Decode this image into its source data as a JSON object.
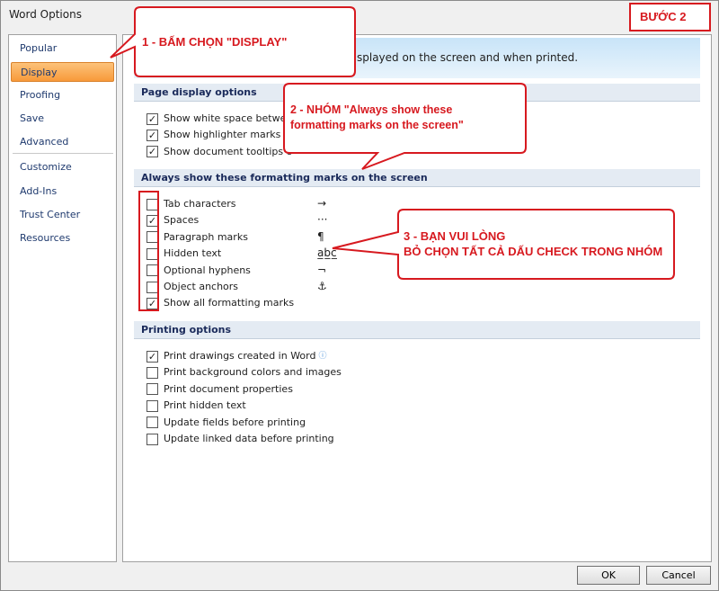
{
  "window": {
    "title": "Word Options"
  },
  "nav": [
    {
      "label": "Popular"
    },
    {
      "label": "Display",
      "selected": true
    },
    {
      "label": "Proofing"
    },
    {
      "label": "Save"
    },
    {
      "label": "Advanced"
    },
    {
      "label": "Customize"
    },
    {
      "label": "Add-Ins"
    },
    {
      "label": "Trust Center"
    },
    {
      "label": "Resources"
    }
  ],
  "banner": "splayed on the screen and when printed.",
  "sections": [
    {
      "title": "Page display options",
      "items": [
        {
          "label": "Show white space between",
          "checked": true
        },
        {
          "label": "Show highlighter marks",
          "checked": true,
          "info": true
        },
        {
          "label": "Show document tooltips o",
          "checked": true
        }
      ]
    },
    {
      "title": "Always show these formatting marks on the screen",
      "items": [
        {
          "label": "Tab characters",
          "checked": false,
          "symbol": "→"
        },
        {
          "label": "Spaces",
          "checked": true,
          "symbol": "···"
        },
        {
          "label": "Paragraph marks",
          "checked": false,
          "symbol": "¶"
        },
        {
          "label": "Hidden text",
          "checked": false,
          "symbol": "a̲b̲c̲"
        },
        {
          "label": "Optional hyphens",
          "checked": false,
          "symbol": "¬"
        },
        {
          "label": "Object anchors",
          "checked": false,
          "symbol": "⚓"
        },
        {
          "label": "Show all formatting marks",
          "checked": true
        }
      ]
    },
    {
      "title": "Printing options",
      "items": [
        {
          "label": "Print drawings created in Word",
          "checked": true,
          "info": true
        },
        {
          "label": "Print background colors and images",
          "checked": false
        },
        {
          "label": "Print document properties",
          "checked": false
        },
        {
          "label": "Print hidden text",
          "checked": false
        },
        {
          "label": "Update fields before printing",
          "checked": false
        },
        {
          "label": "Update linked data before printing",
          "checked": false
        }
      ]
    }
  ],
  "buttons": {
    "ok": "OK",
    "cancel": "Cancel"
  },
  "annotations": {
    "step": "BƯỚC 2",
    "c1": "1 - BẤM CHỌN \"DISPLAY\"",
    "c2a": "2 - NHÓM \"Always show these",
    "c2b": "formatting marks on the screen\"",
    "c3a": "3 - BẠN VUI LÒNG",
    "c3b": "BỎ CHỌN TẤT CẢ DẤU CHECK TRONG NHÓM",
    "color": "#d7191f"
  }
}
